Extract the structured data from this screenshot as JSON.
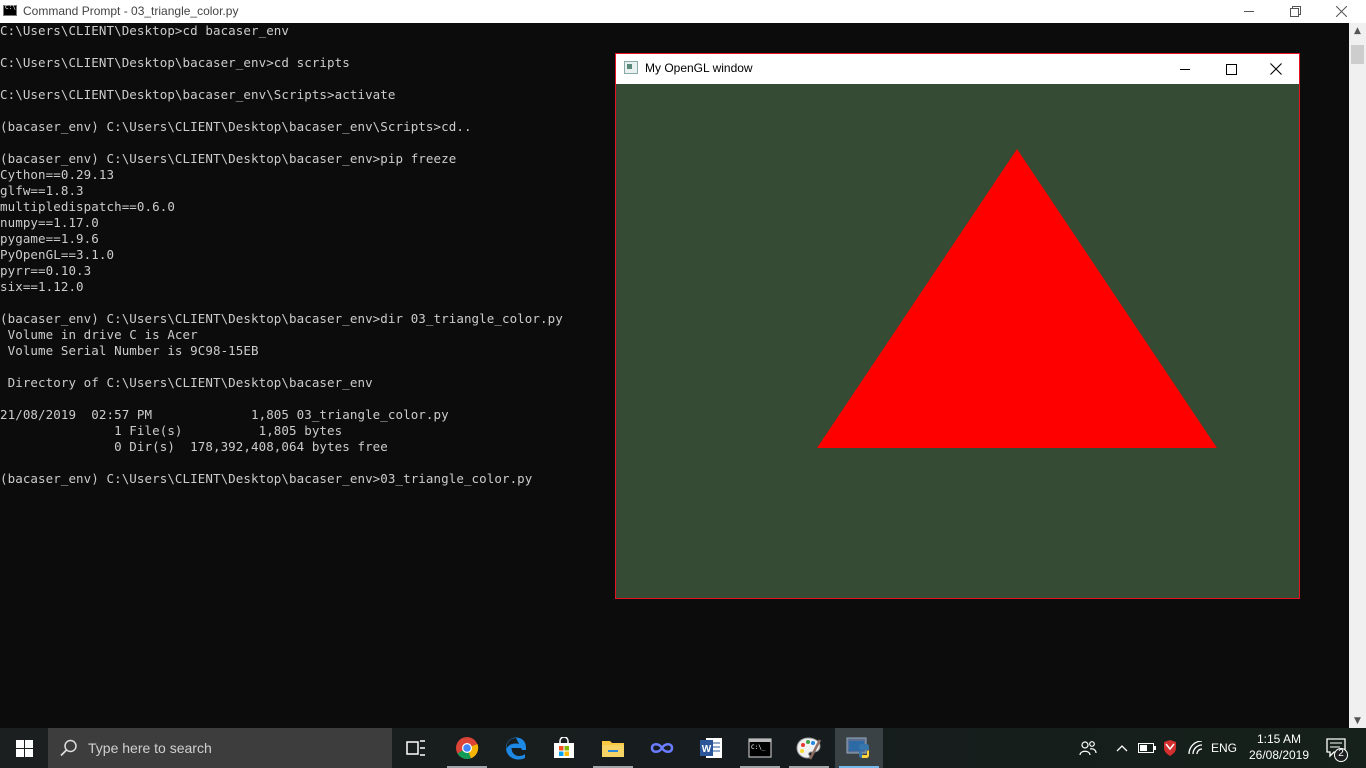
{
  "cmd_window": {
    "title": "Command Prompt - 03_triangle_color.py",
    "lines": [
      "C:\\Users\\CLIENT\\Desktop>cd bacaser_env",
      "",
      "C:\\Users\\CLIENT\\Desktop\\bacaser_env>cd scripts",
      "",
      "C:\\Users\\CLIENT\\Desktop\\bacaser_env\\Scripts>activate",
      "",
      "(bacaser_env) C:\\Users\\CLIENT\\Desktop\\bacaser_env\\Scripts>cd..",
      "",
      "(bacaser_env) C:\\Users\\CLIENT\\Desktop\\bacaser_env>pip freeze",
      "Cython==0.29.13",
      "glfw==1.8.3",
      "multipledispatch==0.6.0",
      "numpy==1.17.0",
      "pygame==1.9.6",
      "PyOpenGL==3.1.0",
      "pyrr==0.10.3",
      "six==1.12.0",
      "",
      "(bacaser_env) C:\\Users\\CLIENT\\Desktop\\bacaser_env>dir 03_triangle_color.py",
      " Volume in drive C is Acer",
      " Volume Serial Number is 9C98-15EB",
      "",
      " Directory of C:\\Users\\CLIENT\\Desktop\\bacaser_env",
      "",
      "21/08/2019  02:57 PM             1,805 03_triangle_color.py",
      "               1 File(s)          1,805 bytes",
      "               0 Dir(s)  178,392,408,064 bytes free",
      "",
      "(bacaser_env) C:\\Users\\CLIENT\\Desktop\\bacaser_env>03_triangle_color.py"
    ]
  },
  "gl_window": {
    "title": "My OpenGL window",
    "clear_color": "#354b33",
    "triangle_color": "#ff0000",
    "border_color": "#e81123"
  },
  "taskbar": {
    "search_placeholder": "Type here to search",
    "pinned": [
      {
        "name": "task-view",
        "icon": "task-view-icon"
      },
      {
        "name": "chrome",
        "icon": "chrome-icon"
      },
      {
        "name": "edge",
        "icon": "edge-icon"
      },
      {
        "name": "store",
        "icon": "store-icon"
      },
      {
        "name": "file-explorer",
        "icon": "folder-icon"
      },
      {
        "name": "infinity-app",
        "icon": "infinity-icon"
      },
      {
        "name": "word",
        "icon": "word-icon"
      },
      {
        "name": "command-prompt",
        "icon": "cmd-icon"
      },
      {
        "name": "paint",
        "icon": "palette-icon"
      },
      {
        "name": "python",
        "icon": "python-icon"
      }
    ],
    "tray": {
      "language": "ENG",
      "time": "1:15 AM",
      "date": "26/08/2019",
      "notification_count": "2"
    }
  }
}
